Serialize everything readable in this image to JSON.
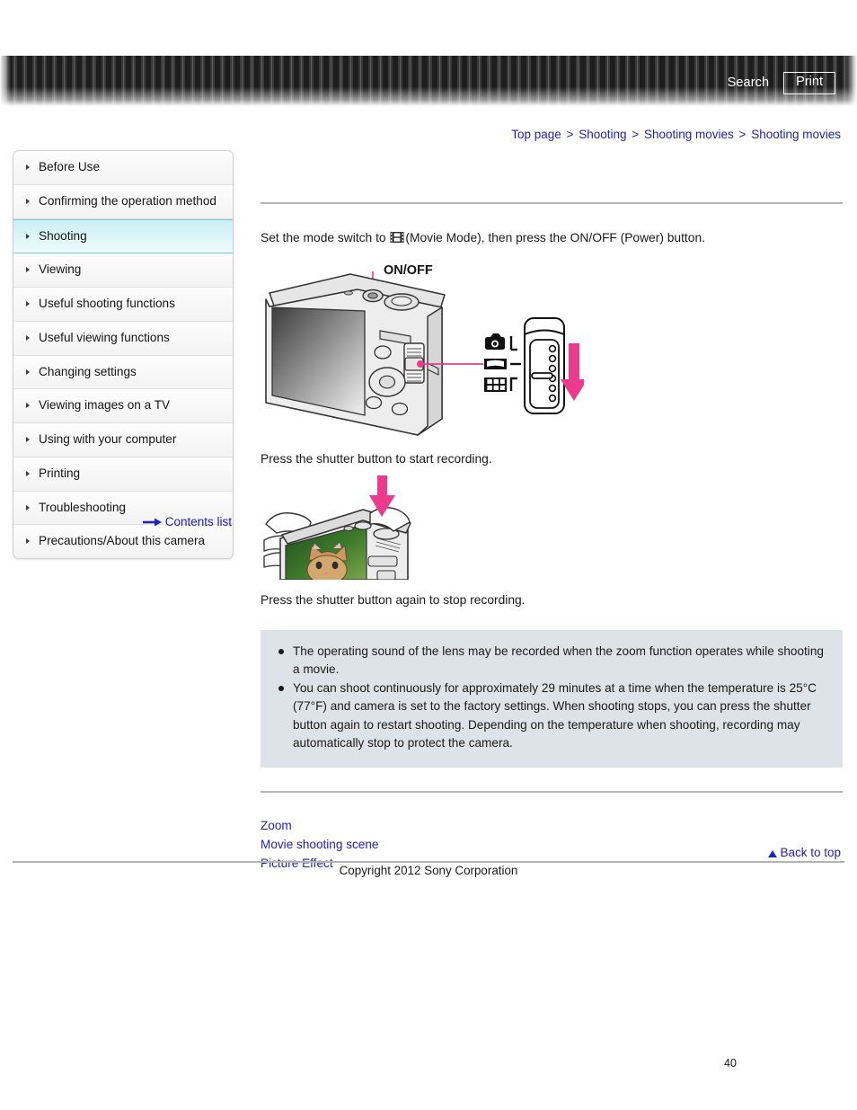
{
  "header": {
    "search_label": "Search",
    "print_label": "Print"
  },
  "breadcrumb": {
    "separator": ">",
    "items": [
      {
        "label": "Top page"
      },
      {
        "label": "Shooting"
      },
      {
        "label": "Shooting movies"
      },
      {
        "label": "Shooting movies"
      }
    ]
  },
  "sidebar": {
    "items": [
      {
        "label": "Before Use",
        "active": false
      },
      {
        "label": "Confirming the operation method",
        "active": false
      },
      {
        "label": "Shooting",
        "active": true
      },
      {
        "label": "Viewing",
        "active": false
      },
      {
        "label": "Useful shooting functions",
        "active": false
      },
      {
        "label": "Useful viewing functions",
        "active": false
      },
      {
        "label": "Changing settings",
        "active": false
      },
      {
        "label": "Viewing images on a TV",
        "active": false
      },
      {
        "label": "Using with your computer",
        "active": false
      },
      {
        "label": "Printing",
        "active": false
      },
      {
        "label": "Troubleshooting",
        "active": false
      },
      {
        "label": "Precautions/About this camera",
        "active": false
      }
    ],
    "contents_list_label": "Contents list"
  },
  "main": {
    "step1_prefix": "Set the mode switch to ",
    "step1_suffix": "(Movie Mode), then press the ON/OFF (Power) button.",
    "step2": "Press the shutter button to start recording.",
    "step3": "Press the shutter button again to stop recording.",
    "figure1": {
      "onoff_label": "ON/OFF",
      "mode_icons": [
        "still-camera-mode-icon",
        "panorama-mode-icon",
        "movie-mode-icon"
      ]
    },
    "notes": [
      "The operating sound of the lens may be recorded when the zoom function operates while shooting a movie.",
      "You can shoot continuously for approximately 29 minutes at a time when the temperature is 25°C (77°F) and camera is set to the factory settings. When shooting stops, you can press the shutter button again to restart shooting. Depending on the temperature when shooting, recording may automatically stop to protect the camera."
    ],
    "related_links": [
      {
        "label": "Zoom"
      },
      {
        "label": "Movie shooting scene"
      },
      {
        "label": "Picture Effect"
      }
    ]
  },
  "footer": {
    "back_to_top_label": "Back to top",
    "copyright": "Copyright 2012 Sony Corporation",
    "page_number": "40"
  },
  "colors": {
    "link": "#2222bb",
    "accent_magenta": "#ed3a8c",
    "note_bg": "#dde3e8",
    "active_nav": "#c8eef5",
    "rule": "#b4b4b4"
  }
}
